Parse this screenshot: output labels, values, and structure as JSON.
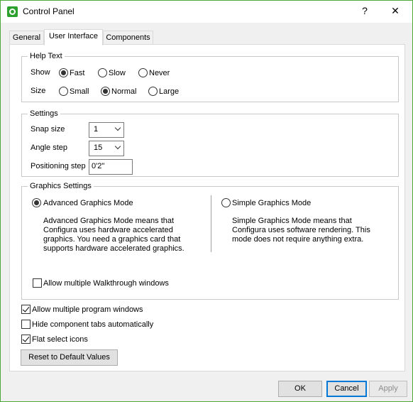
{
  "window": {
    "title": "Control Panel",
    "help_symbol": "?",
    "close_symbol": "✕"
  },
  "tabs": [
    {
      "label": "General"
    },
    {
      "label": "User Interface",
      "active": true
    },
    {
      "label": "Components"
    }
  ],
  "help_text": {
    "title": "Help Text",
    "show_label": "Show",
    "show_options": [
      "Fast",
      "Slow",
      "Never"
    ],
    "show_selected": "Fast",
    "size_label": "Size",
    "size_options": [
      "Small",
      "Normal",
      "Large"
    ],
    "size_selected": "Normal"
  },
  "settings": {
    "title": "Settings",
    "snap_size_label": "Snap size",
    "snap_size_value": "1",
    "angle_step_label": "Angle step",
    "angle_step_value": "15",
    "positioning_step_label": "Positioning step",
    "positioning_step_value": "0'2\""
  },
  "graphics": {
    "title": "Graphics Settings",
    "advanced_label": "Advanced Graphics Mode",
    "advanced_selected": true,
    "advanced_desc": "Advanced Graphics Mode means that\nConfigura uses hardware accelerated\ngraphics. You need a graphics card that\nsupports hardware accelerated graphics.",
    "simple_label": "Simple Graphics Mode",
    "simple_selected": false,
    "simple_desc": "Simple Graphics Mode means that\nConfigura uses software rendering. This\nmode does not require anything extra.",
    "walkthrough_label": "Allow multiple Walkthrough windows",
    "walkthrough_checked": false
  },
  "options": {
    "multiple_program_windows_label": "Allow multiple program windows",
    "multiple_program_windows_checked": true,
    "hide_component_tabs_label": "Hide component tabs automatically",
    "hide_component_tabs_checked": false,
    "flat_select_icons_label": "Flat select icons",
    "flat_select_icons_checked": true
  },
  "buttons": {
    "reset": "Reset to Default Values",
    "ok": "OK",
    "cancel": "Cancel",
    "apply": "Apply"
  },
  "colors": {
    "window_border": "#4ea83a",
    "app_icon": "#2da12d",
    "default_button_border": "#0078d7"
  },
  "icons": {
    "app": "configura-app-icon",
    "help": "question-mark-icon",
    "close": "close-icon",
    "dropdown": "chevron-down-icon"
  }
}
